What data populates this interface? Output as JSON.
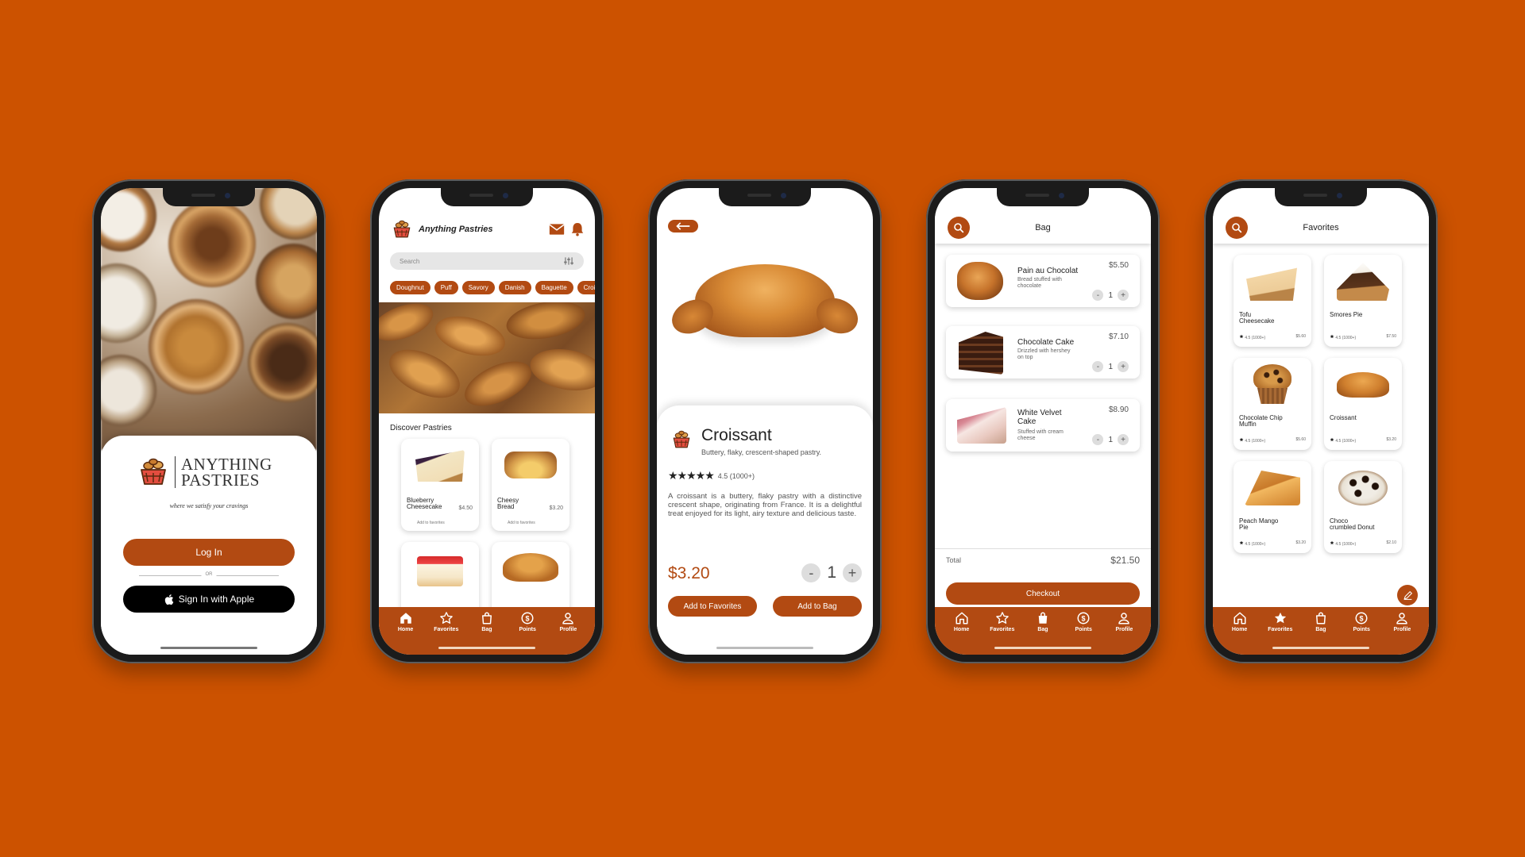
{
  "colors": {
    "background": "#cc5200",
    "brand": "#b24a12",
    "accent": "#9b3f0d"
  },
  "nav": {
    "home": "Home",
    "favorites": "Favorites",
    "bag": "Bag",
    "points": "Points",
    "profile": "Profile"
  },
  "login": {
    "brand_line1": "ANYTHING",
    "brand_line2": "PASTRIES",
    "tagline": "where we satisfy your cravings",
    "login_label": "Log In",
    "or_label": "OR",
    "apple_label": "Sign In with Apple"
  },
  "home": {
    "title": "Anything Pastries",
    "search_placeholder": "Search",
    "categories": [
      "Doughnut",
      "Puff",
      "Savory",
      "Danish",
      "Baguette",
      "Croiss"
    ],
    "section_title": "Discover Pastries",
    "items": [
      {
        "name": "Blueberry Cheesecake",
        "price": "$4.50",
        "fav_label": "Add to favorites"
      },
      {
        "name": "Cheesy Bread",
        "price": "$3.20",
        "fav_label": "Add to favorites"
      }
    ]
  },
  "detail": {
    "name": "Croissant",
    "subtitle": "Buttery, flaky, crescent-shaped pastry.",
    "rating": "4.5 (1000+)",
    "stars": 5,
    "description": "A croissant is a buttery, flaky pastry with a distinctive crescent shape, originating from France. It is a delightful treat enjoyed for its light, airy texture and delicious taste.",
    "price": "$3.20",
    "quantity": "1",
    "minus": "-",
    "plus": "+",
    "fav_button": "Add to Favorites",
    "bag_button": "Add to Bag"
  },
  "bag": {
    "title": "Bag",
    "items": [
      {
        "name": "Pain au Chocolat",
        "desc": "Bread stuffed with chocolate",
        "price": "$5.50",
        "qty": "1"
      },
      {
        "name": "Chocolate Cake",
        "desc": "Drizzled with hershey on top",
        "price": "$7.10",
        "qty": "1"
      },
      {
        "name": "White Velvet Cake",
        "desc": "Stuffed with cream cheese",
        "price": "$8.90",
        "qty": "1"
      }
    ],
    "total_label": "Total",
    "total_value": "$21.50",
    "checkout": "Checkout"
  },
  "favorites": {
    "title": "Favorites",
    "items": [
      {
        "name": "Tofu Cheesecake",
        "rating": "4.5 (1000+)",
        "price": "$5.60"
      },
      {
        "name": "Smores Pie",
        "rating": "4.5 (1000+)",
        "price": "$7.50"
      },
      {
        "name": "Chocolate Chip Muffin",
        "rating": "4.5 (1000+)",
        "price": "$5.60"
      },
      {
        "name": "Croissant",
        "rating": "4.5 (1000+)",
        "price": "$3.20"
      },
      {
        "name": "Peach Mango Pie",
        "rating": "4.5 (1000+)",
        "price": "$3.20"
      },
      {
        "name": "Choco crumbled Donut",
        "rating": "4.5 (1000+)",
        "price": "$2.10"
      }
    ]
  }
}
